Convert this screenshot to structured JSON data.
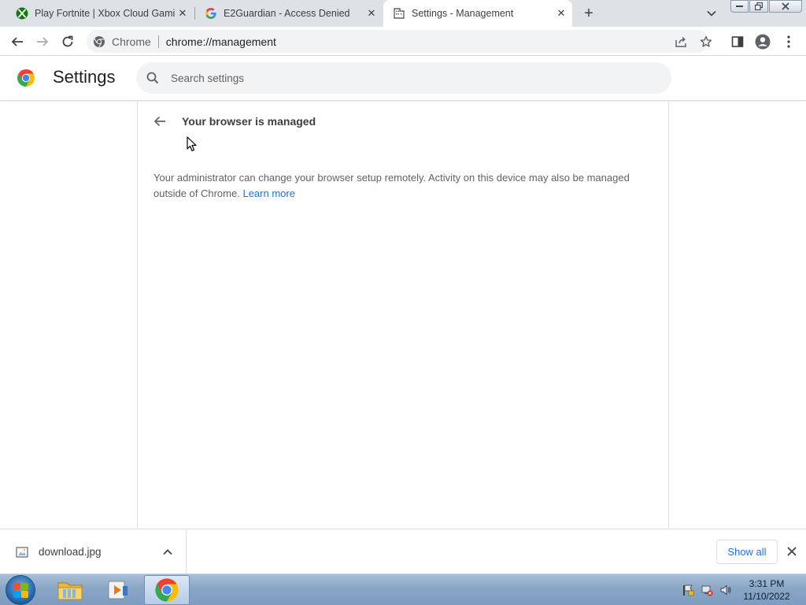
{
  "tabs": [
    {
      "title": "Play Fortnite | Xbox Cloud Gamin",
      "icon": "xbox-icon"
    },
    {
      "title": "E2Guardian - Access Denied",
      "icon": "google-icon"
    },
    {
      "title": "Settings - Management",
      "icon": "building-icon"
    }
  ],
  "toolbar": {
    "chip": "Chrome",
    "url": "chrome://management"
  },
  "settings": {
    "title": "Settings",
    "search_placeholder": "Search settings"
  },
  "management": {
    "heading": "Your browser is managed",
    "description": "Your administrator can change your browser setup remotely. Activity on this device may also be managed outside of Chrome.",
    "learn_more": "Learn more"
  },
  "downloads": {
    "file_name": "download.jpg",
    "show_all": "Show all"
  },
  "taskbar": {
    "time": "3:31 PM",
    "date": "11/10/2022"
  },
  "colors": {
    "accent": "#1a73e8",
    "tabstrip": "#dee1e6",
    "omnibox": "#f1f3f4"
  }
}
